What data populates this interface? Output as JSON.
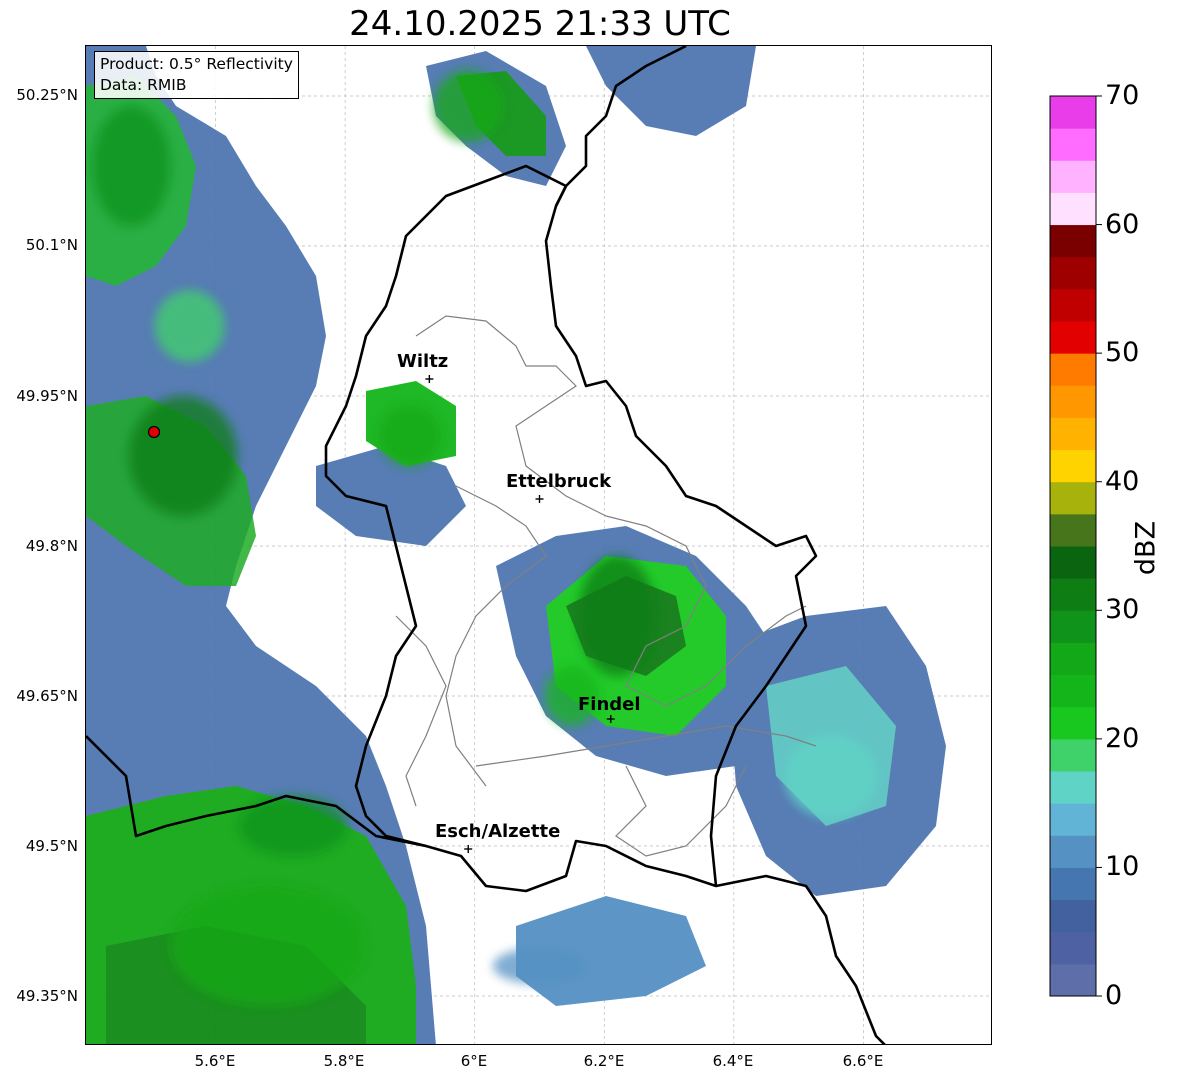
{
  "title": "24.10.2025 21:33 UTC",
  "product_box": {
    "line1": "Product: 0.5° Reflectivity",
    "line2": "Data: RMIB"
  },
  "axes": {
    "lat_ticks": [
      "50.25°N",
      "50.1°N",
      "49.95°N",
      "49.8°N",
      "49.65°N",
      "49.5°N",
      "49.35°N"
    ],
    "lon_ticks": [
      "5.6°E",
      "5.8°E",
      "6°E",
      "6.2°E",
      "6.4°E",
      "6.6°E"
    ]
  },
  "cities": [
    {
      "name": "Wiltz"
    },
    {
      "name": "Ettelbruck"
    },
    {
      "name": "Findel"
    },
    {
      "name": "Esch/Alzette"
    }
  ],
  "colorbar": {
    "title": "dBZ",
    "tick_labels": [
      "0",
      "10",
      "20",
      "30",
      "40",
      "50",
      "60",
      "70"
    ],
    "min": 0,
    "max": 70,
    "step": 2.5,
    "colors": [
      "#5e6ea8",
      "#4e62a3",
      "#43609f",
      "#4676b0",
      "#5591c3",
      "#62b4d6",
      "#5fd4c6",
      "#3fd26b",
      "#18c81f",
      "#14b51b",
      "#13a817",
      "#10931a",
      "#0e7d14",
      "#0b6510",
      "#47751c",
      "#a8b20d",
      "#ffd300",
      "#ffb200",
      "#ff9800",
      "#ff7b00",
      "#e20000",
      "#c00000",
      "#9e0000",
      "#7a0000",
      "#ffe0ff",
      "#ffb2ff",
      "#ff6cff",
      "#e83de8"
    ]
  },
  "chart_data": {
    "type": "heatmap",
    "title": "24.10.2025 21:33 UTC",
    "xlabel": "",
    "ylabel": "",
    "xlim": [
      5.4,
      6.8
    ],
    "ylim": [
      49.3,
      50.3
    ],
    "x_ticks": [
      5.6,
      5.8,
      6.0,
      6.2,
      6.4,
      6.6
    ],
    "y_ticks": [
      49.35,
      49.5,
      49.65,
      49.8,
      49.95,
      50.1,
      50.25
    ],
    "colorbar_label": "dBZ",
    "colorbar_range": [
      0,
      70
    ],
    "radar_site": {
      "lon": 5.505,
      "lat": 49.914
    },
    "cities": [
      {
        "name": "Wiltz",
        "lon": 5.93,
        "lat": 49.967
      },
      {
        "name": "Ettelbruck",
        "lon": 6.1,
        "lat": 49.847
      },
      {
        "name": "Findel",
        "lon": 6.21,
        "lat": 49.627
      },
      {
        "name": "Esch/Alzette",
        "lon": 5.99,
        "lat": 49.497
      }
    ],
    "echo_cells": [
      {
        "lon": 5.47,
        "lat": 50.18,
        "rx": 0.1,
        "ry": 0.1,
        "dbz": 28
      },
      {
        "lon": 5.55,
        "lat": 49.89,
        "rx": 0.14,
        "ry": 0.1,
        "dbz": 30
      },
      {
        "lon": 5.56,
        "lat": 50.02,
        "rx": 0.09,
        "ry": 0.06,
        "dbz": 18
      },
      {
        "lon": 5.9,
        "lat": 49.91,
        "rx": 0.08,
        "ry": 0.05,
        "dbz": 26
      },
      {
        "lon": 5.99,
        "lat": 50.24,
        "rx": 0.09,
        "ry": 0.06,
        "dbz": 27
      },
      {
        "lon": 6.22,
        "lat": 49.73,
        "rx": 0.1,
        "ry": 0.1,
        "dbz": 32
      },
      {
        "lon": 6.15,
        "lat": 49.65,
        "rx": 0.07,
        "ry": 0.05,
        "dbz": 24
      },
      {
        "lon": 6.55,
        "lat": 49.57,
        "rx": 0.12,
        "ry": 0.07,
        "dbz": 16
      },
      {
        "lon": 5.68,
        "lat": 49.4,
        "rx": 0.25,
        "ry": 0.1,
        "dbz": 25
      },
      {
        "lon": 5.72,
        "lat": 49.52,
        "rx": 0.14,
        "ry": 0.05,
        "dbz": 28
      },
      {
        "lon": 6.1,
        "lat": 49.38,
        "rx": 0.12,
        "ry": 0.03,
        "dbz": 10
      }
    ]
  }
}
